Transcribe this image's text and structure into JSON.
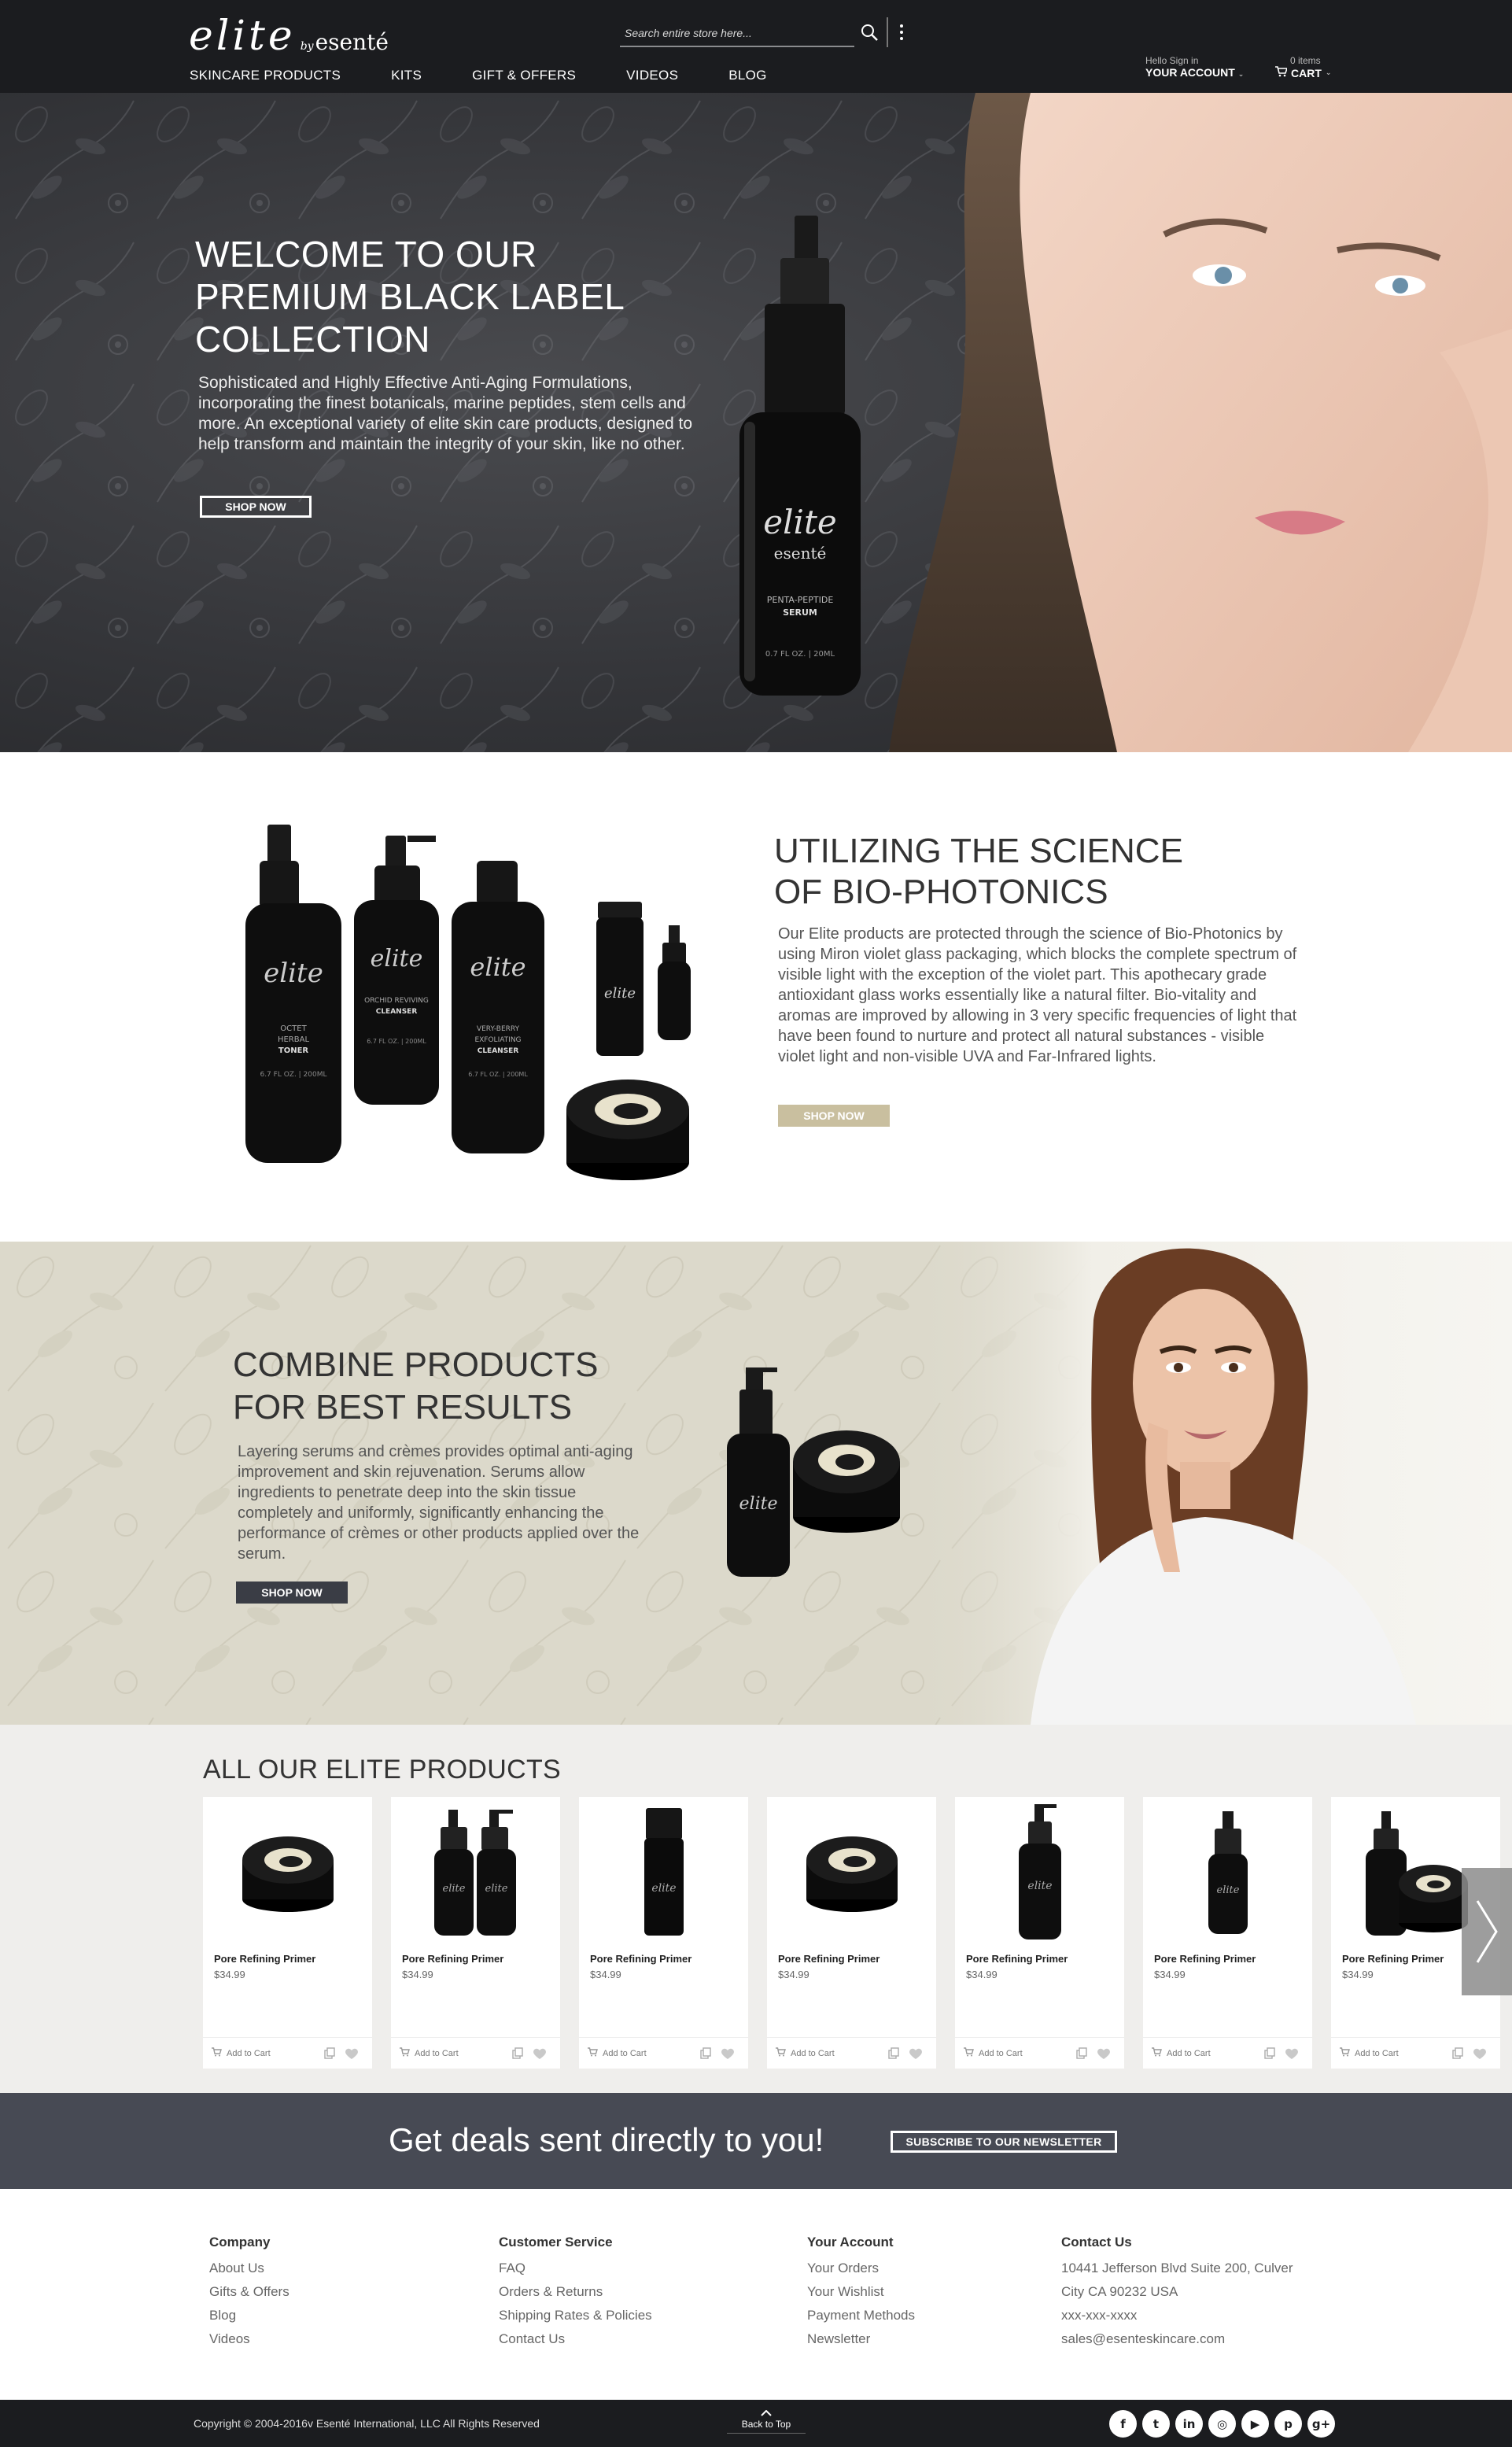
{
  "header": {
    "logo": {
      "elite": "elite",
      "by": "by",
      "esente": "esenté"
    },
    "search": {
      "placeholder": "Search entire store here..."
    },
    "nav": [
      "SKINCARE PRODUCTS",
      "KITS",
      "GIFT & OFFERS",
      "VIDEOS",
      "BLOG"
    ],
    "account": {
      "greeting": "Hello Sign in",
      "label": "YOUR ACCOUNT"
    },
    "cart": {
      "count": "0 items",
      "label": "CART"
    },
    "icons": [
      "search-icon",
      "kebab-menu-icon",
      "caret-down-icon",
      "cart-icon"
    ]
  },
  "hero": {
    "title": [
      "WELCOME TO OUR",
      "PREMIUM BLACK LABEL",
      "COLLECTION"
    ],
    "body": "Sophisticated and Highly Effective Anti-Aging Formulations, incorporating the finest botanicals, marine peptides, stem cells and more. An exceptional variety of elite skin care products, designed to help transform and maintain the integrity of your skin, like no other.",
    "button": "SHOP NOW",
    "bottle": {
      "brand": "elite",
      "by": "by",
      "esente": "esenté",
      "line1": "PENTA-PEPTIDE",
      "line2": "SERUM",
      "volume": "0.7 FL OZ.  |  20ML"
    }
  },
  "science": {
    "title": [
      "UTILIZING THE SCIENCE",
      "OF BIO-PHOTONICS"
    ],
    "body": "Our Elite products are protected through the science of Bio-Photonics by using Miron violet glass packaging, which blocks the complete spectrum of visible light with the exception of the violet part. This apothecary grade antioxidant glass works essentially like a natural filter. Bio-vitality and aromas are improved by allowing in 3 very specific frequencies of light that have been found to nurture and protect all natural substances - visible violet light and non-visible UVA and Far-Infrared lights.",
    "button": "SHOP NOW",
    "bottles": [
      {
        "l1": "OCTET",
        "l2": "HERBAL",
        "l3": "TONER",
        "vol": "6.7 FL OZ.  |  200ML"
      },
      {
        "l1": "ORCHID REVIVING",
        "l2": "CLEANSER",
        "l3": "",
        "vol": "6.7 FL OZ.  |  200ML"
      },
      {
        "l1": "VERY-BERRY",
        "l2": "EXFOLIATING",
        "l3": "CLEANSER",
        "vol": "6.7 FL OZ.  |  200ML"
      }
    ]
  },
  "combine": {
    "title": [
      "COMBINE PRODUCTS",
      "FOR BEST RESULTS"
    ],
    "body": "Layering serums and crèmes provides optimal anti-aging improvement and skin rejuvenation. Serums allow ingredients to penetrate deep into the skin tissue completely and uniformly, significantly enhancing the performance of crèmes or other products applied over the serum.",
    "button": "SHOP NOW"
  },
  "products": {
    "heading": "ALL OUR ELITE PRODUCTS",
    "add_label": "Add to Cart",
    "items": [
      {
        "name": "Pore Refining Primer",
        "price": "$34.99",
        "img": "jar"
      },
      {
        "name": "Pore Refining Primer",
        "price": "$34.99",
        "img": "pump-pair"
      },
      {
        "name": "Pore Refining Primer",
        "price": "$34.99",
        "img": "slim-bottle"
      },
      {
        "name": "Pore Refining Primer",
        "price": "$34.99",
        "img": "jar"
      },
      {
        "name": "Pore Refining Primer",
        "price": "$34.99",
        "img": "pump-tall"
      },
      {
        "name": "Pore Refining Primer",
        "price": "$34.99",
        "img": "pump-small"
      },
      {
        "name": "Pore Refining Primer",
        "price": "$34.99",
        "img": "pump-jar"
      }
    ]
  },
  "newsletter": {
    "text": "Get deals sent directly to you!",
    "button": "SUBSCRIBE TO OUR NEWSLETTER"
  },
  "footer": {
    "company": {
      "title": "Company",
      "links": [
        "About Us",
        "Gifts & Offers",
        "Blog",
        "Videos"
      ]
    },
    "service": {
      "title": "Customer Service",
      "links": [
        "FAQ",
        "Orders & Returns",
        "Shipping Rates & Policies",
        "Contact Us"
      ]
    },
    "account": {
      "title": "Your Account",
      "links": [
        "Your Orders",
        "Your Wishlist",
        "Payment Methods",
        "Newsletter"
      ]
    },
    "contact": {
      "title": "Contact Us",
      "lines": [
        "10441 Jefferson Blvd Suite 200, Culver",
        "City CA 90232 USA",
        "xxx-xxx-xxxx",
        "sales@esenteskincare.com"
      ]
    }
  },
  "bottom": {
    "copyright": "Copyright © 2004-2016v Esenté International, LLC All Rights Reserved",
    "back_to_top": "Back to Top",
    "social": [
      {
        "name": "facebook-icon",
        "glyph": "f"
      },
      {
        "name": "twitter-icon",
        "glyph": "t"
      },
      {
        "name": "linkedin-icon",
        "glyph": "in"
      },
      {
        "name": "instagram-icon",
        "glyph": "◎"
      },
      {
        "name": "youtube-icon",
        "glyph": "▶"
      },
      {
        "name": "pinterest-icon",
        "glyph": "p"
      },
      {
        "name": "google-plus-icon",
        "glyph": "g+"
      }
    ]
  },
  "colors": {
    "header_bg": "#1b1c1f",
    "hero_bg": "#35363a",
    "tan_accent": "#c9bf9f",
    "combine_bg": "#dcd9cb",
    "products_bg": "#efeeec",
    "newsletter_bg": "#474a54"
  }
}
